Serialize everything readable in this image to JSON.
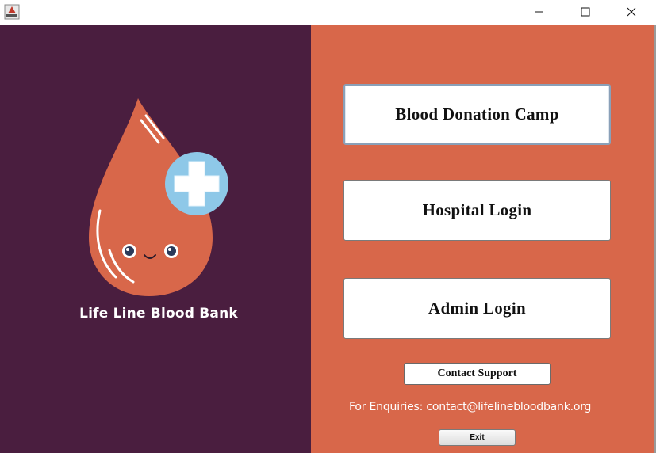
{
  "window": {
    "icons": {
      "app": "app-icon",
      "minimize": "minimize-icon",
      "maximize": "maximize-icon",
      "close": "close-icon"
    }
  },
  "left_panel": {
    "background": "#4a1e3f",
    "bank_name": "Life Line Blood Bank",
    "logo": "blood-drop-with-plus-icon"
  },
  "right_panel": {
    "background": "#d8674a",
    "buttons": {
      "blood_donation_camp": "Blood Donation Camp",
      "hospital_login": "Hospital Login",
      "admin_login": "Admin Login",
      "contact_support": "Contact Support",
      "exit": "Exit"
    },
    "enquiries_text": "For Enquiries: contact@lifelinebloodbank.org"
  }
}
